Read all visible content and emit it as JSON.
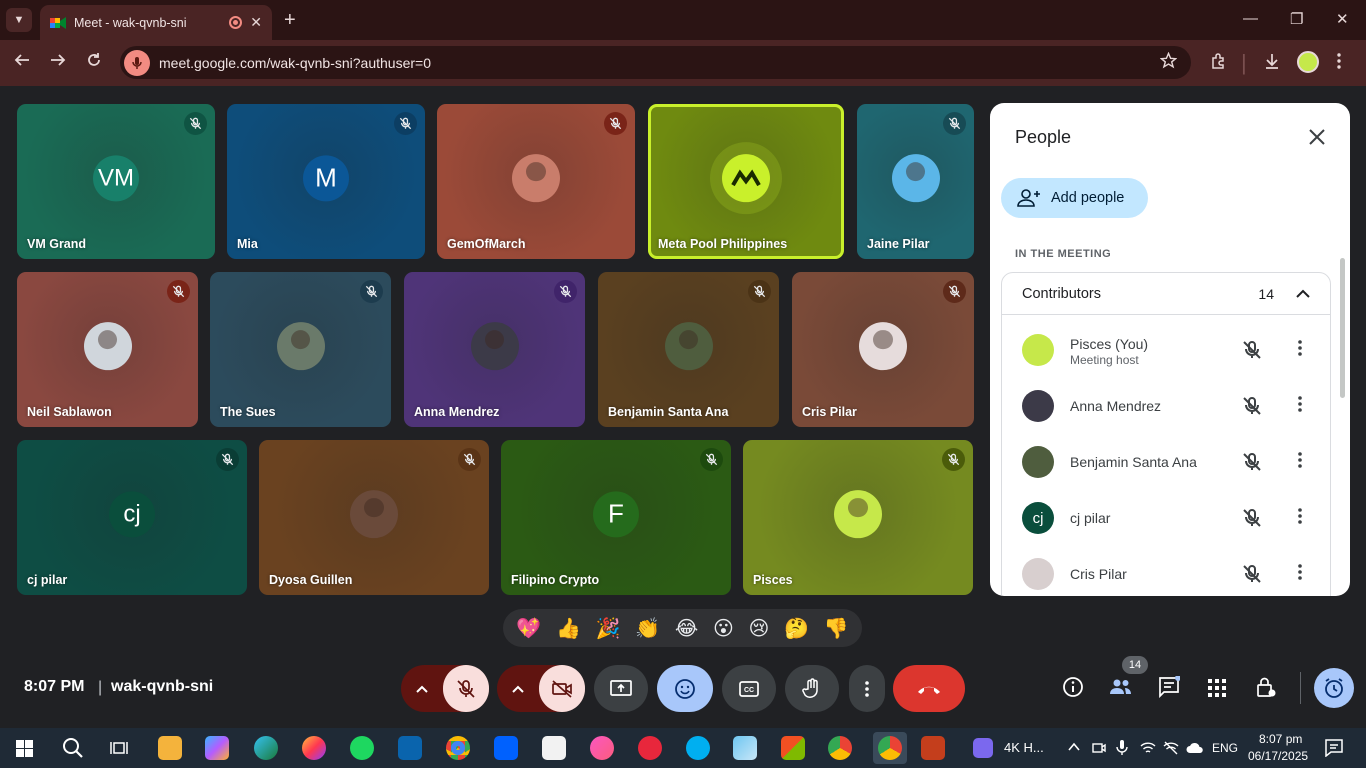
{
  "browser": {
    "tab_title": "Meet - wak-qvnb-sni",
    "url": "meet.google.com/wak-qvnb-sni?authuser=0",
    "new_tab_glyph": "+",
    "close_tab_glyph": "✕",
    "window_controls": {
      "minimize": "—",
      "restore": "❐",
      "close": "✕"
    }
  },
  "tiles": [
    {
      "name": "VM Grand",
      "initials": "VM",
      "color": "#1a6b55",
      "avatar_color": "#18806a",
      "mute_bg": "#0f5443"
    },
    {
      "name": "Mia",
      "initials": "M",
      "color": "#0e4d7a",
      "avatar_color": "#0b5797",
      "mute_bg": "#0c3e63"
    },
    {
      "name": "GemOfMarch",
      "initials": "",
      "color": "#9b4a38",
      "avatar_color": "#c97d6b",
      "mute_bg": "#7a2418"
    },
    {
      "name": "Meta Pool Philippines",
      "initials": "",
      "color": "#6f8a10",
      "avatar_color": "#c9f02b",
      "mute_bg": ""
    },
    {
      "name": "Jaine Pilar",
      "initials": "",
      "color": "#1f6670",
      "avatar_color": "#5bb6e8",
      "mute_bg": "#174b55"
    },
    {
      "name": "Neil Sablawon",
      "initials": "",
      "color": "#8a4840",
      "avatar_color": "#d0d6dc",
      "mute_bg": "#7a2418"
    },
    {
      "name": "The Sues",
      "initials": "",
      "color": "#2c4b5c",
      "avatar_color": "#6a7a6a",
      "mute_bg": "#1d3c4e"
    },
    {
      "name": "Anna Mendrez",
      "initials": "",
      "color": "#4f3478",
      "avatar_color": "#3c3a48",
      "mute_bg": "#40246a"
    },
    {
      "name": "Benjamin Santa Ana",
      "initials": "",
      "color": "#5a4020",
      "avatar_color": "#4f5d3e",
      "mute_bg": "#4b3316"
    },
    {
      "name": "Cris Pilar",
      "initials": "",
      "color": "#7a4a38",
      "avatar_color": "#e6dcdc",
      "mute_bg": "#5e2a1a"
    },
    {
      "name": "cj pilar",
      "initials": "cj",
      "color": "#0e4d44",
      "avatar_color": "#0a4e3c",
      "mute_bg": "#0a3d35"
    },
    {
      "name": "Dyosa Guillen",
      "initials": "",
      "color": "#6a4220",
      "avatar_color": "#6a4a3a",
      "mute_bg": "#5a3416"
    },
    {
      "name": "Filipino Crypto",
      "initials": "F",
      "color": "#2b5a14",
      "avatar_color": "#256b1c",
      "mute_bg": "#1d4a0e"
    },
    {
      "name": "Pisces",
      "initials": "",
      "color": "#758a20",
      "avatar_color": "#c6e84a",
      "mute_bg": "#4b5c0a"
    }
  ],
  "people_panel": {
    "title": "People",
    "add_people_label": "Add people",
    "section_label": "IN THE MEETING",
    "group_label": "Contributors",
    "group_count": "14",
    "participants": [
      {
        "name": "Pisces (You)",
        "sub": "Meeting host",
        "initials": "",
        "color": "#c6e84a"
      },
      {
        "name": "Anna Mendrez",
        "sub": "",
        "initials": "",
        "color": "#3c3a48"
      },
      {
        "name": "Benjamin Santa Ana",
        "sub": "",
        "initials": "",
        "color": "#4f5d3e"
      },
      {
        "name": "cj pilar",
        "sub": "",
        "initials": "cj",
        "color": "#0a4e3c"
      },
      {
        "name": "Cris Pilar",
        "sub": "",
        "initials": "",
        "color": "#d8cfcf"
      }
    ]
  },
  "reactions": [
    "💖",
    "👍",
    "🎉",
    "👏",
    "😂",
    "😮",
    "😢",
    "🤔",
    "👎"
  ],
  "meeting_bar": {
    "time": "8:07 PM",
    "separator": "|",
    "meeting_code": "wak-qvnb-sni",
    "people_count": "14",
    "colors": {
      "muted": "#f9dedc",
      "arrow_bg": "#601410",
      "active": "#a8c7fa",
      "neutral": "#3c4043",
      "end": "#dc362e",
      "activities": "#a8c7fa"
    }
  },
  "taskbar": {
    "pinned_label": "4K H...",
    "language": "ENG",
    "clock_time": "8:07 pm",
    "clock_date": "06/17/2025"
  }
}
